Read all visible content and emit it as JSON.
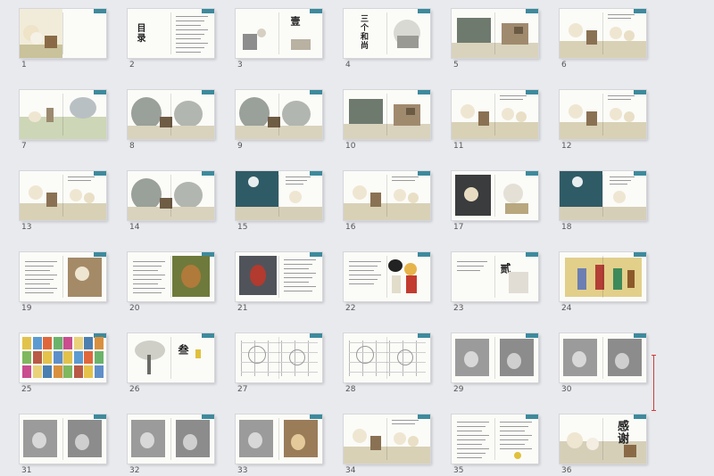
{
  "pages": [
    {
      "num": "1",
      "style": "cover"
    },
    {
      "num": "2",
      "style": "toc",
      "title": "目录"
    },
    {
      "num": "3",
      "style": "bell",
      "title": "壹"
    },
    {
      "num": "4",
      "style": "title",
      "title": "三个和尚"
    },
    {
      "num": "5",
      "style": "temple"
    },
    {
      "num": "6",
      "style": "monks"
    },
    {
      "num": "7",
      "style": "landscape"
    },
    {
      "num": "8",
      "style": "mountain"
    },
    {
      "num": "9",
      "style": "mountain"
    },
    {
      "num": "10",
      "style": "temple"
    },
    {
      "num": "11",
      "style": "monks"
    },
    {
      "num": "12",
      "style": "monks"
    },
    {
      "num": "13",
      "style": "monks"
    },
    {
      "num": "14",
      "style": "mountain"
    },
    {
      "num": "15",
      "style": "night"
    },
    {
      "num": "16",
      "style": "monks"
    },
    {
      "num": "17",
      "style": "dark"
    },
    {
      "num": "18",
      "style": "night"
    },
    {
      "num": "19",
      "style": "text-image"
    },
    {
      "num": "20",
      "style": "photo"
    },
    {
      "num": "21",
      "style": "photo-red"
    },
    {
      "num": "22",
      "style": "cartoon"
    },
    {
      "num": "23",
      "style": "sketch",
      "title": "贰"
    },
    {
      "num": "24",
      "style": "color-panel"
    },
    {
      "num": "25",
      "style": "color-grid"
    },
    {
      "num": "26",
      "style": "tree",
      "title": "叁"
    },
    {
      "num": "27",
      "style": "lineart"
    },
    {
      "num": "28",
      "style": "lineart"
    },
    {
      "num": "29",
      "style": "grey"
    },
    {
      "num": "30",
      "style": "grey"
    },
    {
      "num": "31",
      "style": "grey"
    },
    {
      "num": "32",
      "style": "grey"
    },
    {
      "num": "33",
      "style": "grey-color"
    },
    {
      "num": "34",
      "style": "monks"
    },
    {
      "num": "35",
      "style": "text"
    },
    {
      "num": "36",
      "style": "thanks",
      "title": "感谢"
    }
  ],
  "colors": {
    "accent_tab": "#3d8a9c",
    "scroll_marker": "#d23a3a"
  }
}
